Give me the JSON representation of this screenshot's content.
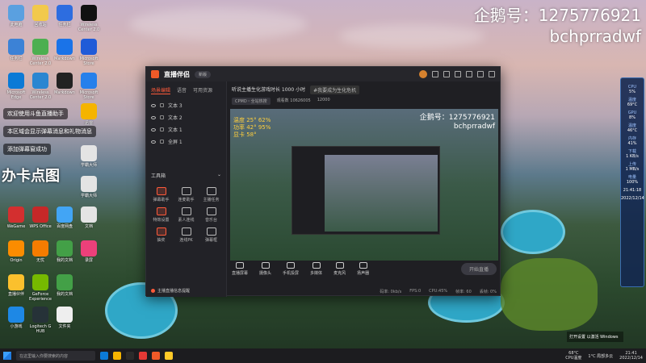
{
  "watermark": {
    "line1": "企鹅号：1275776921",
    "line2": "bchprradwf"
  },
  "chat": [
    "欢迎使用斗鱼直播助手",
    "本区域会显示弹幕消息和礼物消息",
    "添加弹幕窗成功"
  ],
  "overlay_tag": "办卡点图",
  "desktop_icons": [
    "此电脑",
    "回收站",
    "任务栏",
    "Microsoft Edge",
    "Wireless Center 2.0",
    "Markdown",
    "Nvidia Control",
    "Microsoft Store",
    "Steam",
    "迅雷",
    "Camtasia",
    "腾讯QQ",
    "Adobe",
    "QQ音乐",
    "学霸大师",
    "WeGame",
    "WPS Office",
    "百度网盘",
    "文档",
    "录屏",
    "Origin",
    "无忧",
    "我的文档",
    "直播伙伴",
    "GeForce Experience",
    "NVIDIA",
    "小游戏",
    "Logitech G HUB",
    "文件夹"
  ],
  "app": {
    "title": "直播伴侣",
    "version": "新版",
    "tabs": [
      "场景编辑",
      "语音",
      "可用资源"
    ],
    "layers": [
      "文本 3",
      "文本 2",
      "文本 1",
      "全屏 1"
    ],
    "tools_header": "工具箱",
    "tools": [
      "弹幕助手",
      "连麦助手",
      "主播任务",
      "特效设置",
      "素人连线",
      "音乐台",
      "抽奖",
      "连线PK",
      "弹幕框",
      "PK",
      "更多",
      "设置"
    ],
    "notice": "主播直播信息提醒",
    "info_title": "听说主播生化游戏时长 1000 小时",
    "info_tag": "#我要成为生化危机",
    "info_pills": [
      "CPMD・全站热搜",
      "观看数 10626005",
      "12000"
    ],
    "preview_wm_1": "企鹅号：1275776921",
    "preview_wm_2": "bchprradwf",
    "overlay_lines": [
      "温度 25°  62%",
      "功率 42°  95%",
      "显卡 58°"
    ],
    "bottom_actions": [
      "直播屏幕",
      "摄像头",
      "手机投屏",
      "多媒体",
      "麦克风",
      "扬声器"
    ],
    "go_live": "开始直播",
    "status": [
      "码率: 0kb/s",
      "FPS:0",
      "CPU:45%",
      "帧率: 60",
      "丢帧: 0%"
    ]
  },
  "widget": [
    {
      "label": "CPU",
      "value": "5%"
    },
    {
      "label": "温度",
      "value": "69°C"
    },
    {
      "label": "GPU",
      "value": "8%"
    },
    {
      "label": "温度",
      "value": "46°C"
    },
    {
      "label": "内存",
      "value": "41%"
    },
    {
      "label": "下载",
      "value": "1 KB/s"
    },
    {
      "label": "上传",
      "value": "1 MB/s"
    },
    {
      "label": "电量",
      "value": "100%"
    },
    {
      "label": "时间",
      "value": "21:41:18"
    },
    {
      "label": "日期",
      "value": "2022/12/14"
    }
  ],
  "notify": "打开设置 以激活 Windows",
  "taskbar": {
    "search_placeholder": "在这里输入你要搜索的内容",
    "temp": "68°C",
    "temp_label": "CPU温度",
    "weather": "1°C 局部多云",
    "time": "21:41",
    "date": "2022/12/14"
  }
}
